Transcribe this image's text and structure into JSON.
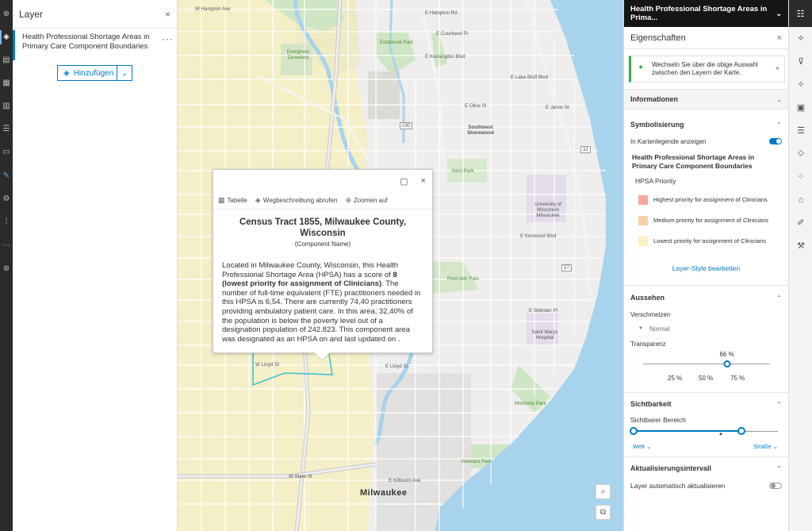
{
  "left_rail": {
    "icons": [
      "add-icon",
      "layers-icon",
      "table-icon",
      "charts-icon",
      "chart-bar-icon",
      "legend-icon",
      "bookmark-icon",
      "sketch-icon",
      "settings-icon",
      "hint-icon",
      "share-icon",
      "help-icon"
    ]
  },
  "layer_panel": {
    "title": "Layer",
    "close": "×",
    "item_label": "Health Professional Shortage Areas in Primary Care Component Boundaries",
    "item_more": "···",
    "add_button": "Hinzufügen",
    "add_dropdown": "⌄"
  },
  "map": {
    "labels": {
      "hampton": "W Hampton Ave",
      "hampton_e": "E Hampton Rd",
      "courtland": "E Courtland Pl",
      "kensington": "E Kensington Blvd",
      "lake_bluff": "E Lake Bluff Blvd",
      "olive": "E Olive St",
      "jarvis": "E Jarvis St",
      "evergreen": "Evergreen Cemetery",
      "estabrook": "Estabrook Park",
      "southwest_shorewood": "Southwest Shorewood",
      "kern": "Kern Park",
      "uwm": "University of Wisconsin Milwaukee",
      "kenwood": "E Kenwood Blvd",
      "riverside": "Riverside Park",
      "webster": "E Webster Pl",
      "st_marys": "Saint Marys Hospital",
      "lloyd": "W Lloyd St",
      "lloyd_e": "E Lloyd St",
      "mckinley": "McKinley Park",
      "veterans": "Veterans Park",
      "state": "W State St",
      "kilbourn": "E Kilbourn Ave",
      "milwaukee": "Milwaukee",
      "shield_190": "190",
      "shield_32": "32",
      "shield_57": "57"
    },
    "controls": {
      "search": "⌕",
      "expand": "⧉"
    }
  },
  "popup": {
    "dock_icon": "▢",
    "close_icon": "×",
    "actions": [
      "Tabelle",
      "Wegbeschreibung abrufen",
      "Zoomen auf"
    ],
    "action_icons": [
      "table-icon",
      "directions-icon",
      "zoom-to-icon"
    ],
    "title": "Census Tract 1855, Milwaukee County, Wisconsin",
    "subtitle": "(Component Name)",
    "body_pre": "Located in Milwaukee County, Wisconsin, this Health Professional Shortage Area (HPSA) has a score of ",
    "body_bold": "8 (lowest priority for assignment of Clinicians)",
    "body_post": ". The number of full-time equivalent (FTE) practitioners needed in this HPSA is 6,54. There are currently 74,40 practitioners providing ambulatory patient care. In this area, 32,40% of the population is below the poverty level out of a designation population of 242.823. This component area was designated as an HPSA on  and last updated on ."
  },
  "properties": {
    "layer_name": "Health Professional Shortage Areas in Prima...",
    "panel_title": "Eigenschaften",
    "notice": "Wechseln Sie über die obige Auswahl zwischen den Layern der Karte.",
    "info_section": "Informationen",
    "symbology_section": "Symbolisierung",
    "show_in_legend": "In Kartenlegende anzeigen",
    "legend_title": "Health Professional Shortage Areas in Primary Care Component Boundaries",
    "legend_field": "HPSA Priority",
    "legend": [
      {
        "label": "Highest priority for assignment of Clinicians",
        "color": "#f4a8a0"
      },
      {
        "label": "Medium priority for assignment of Clinicians",
        "color": "#f6d3a6"
      },
      {
        "label": "Lowest priority for assignment of Clinicians",
        "color": "#fbf1c2"
      }
    ],
    "edit_style": "Layer-Style bearbeiten",
    "appearance_section": "Aussehen",
    "blend_label": "Verschmelzen",
    "blend_value": "Normal",
    "transparency_label": "Transparenz",
    "transparency_value": "66 %",
    "transparency": 0.66,
    "transparency_ticks": [
      "25 %",
      "50 %",
      "75 %"
    ],
    "visibility_section": "Sichtbarkeit",
    "visible_range": "Sichtbarer Bereich",
    "range_min": "Welt",
    "range_max": "Straße",
    "refresh_section": "Aktualisierungsintervall",
    "auto_refresh": "Layer automatisch aktualisieren"
  },
  "right_rail": {
    "icons": [
      "properties-icon",
      "styles-icon",
      "filter-icon",
      "effects-icon",
      "popups-icon",
      "fields-icon",
      "labels-icon",
      "configure-clusters-icon",
      "form-icon",
      "edit-icon",
      "tools-icon"
    ]
  },
  "colors": {
    "accent": "#007ac2",
    "tract_highlight": "#3ec2d6",
    "hpsa_low": "#fbf1c2",
    "notice_green": "#35ac46"
  }
}
